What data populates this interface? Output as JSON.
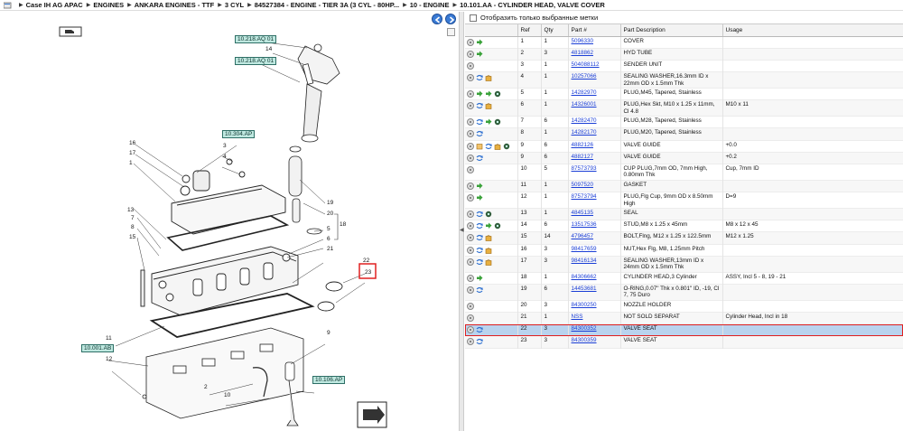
{
  "breadcrumb": {
    "items": [
      "Case IH AG APAC",
      "ENGINES",
      "ANKARA ENGINES - TTF",
      "3 CYL",
      "84527384 - ENGINE - TIER 3A (3 CYL - 80HP...",
      "10 - ENGINE",
      "10.101.AA - CYLINDER HEAD, VALVE COVER"
    ]
  },
  "filter": {
    "label": "Отобразить только выбранные метки",
    "checked": false
  },
  "table": {
    "headers": [
      "",
      "Ref",
      "Qty",
      "Part #",
      "Part Description",
      "Usage"
    ],
    "rows": [
      {
        "icons": [
          "circle-icon",
          "green-arrow-icon"
        ],
        "ref": "1",
        "qty": "1",
        "part": "5096330",
        "desc": "COVER",
        "usage": ""
      },
      {
        "icons": [
          "circle-icon",
          "green-arrow-icon"
        ],
        "ref": "2",
        "qty": "3",
        "part": "4818862",
        "desc": "HYD TUBE",
        "usage": ""
      },
      {
        "icons": [
          "circle-icon"
        ],
        "ref": "3",
        "qty": "1",
        "part": "504088112",
        "desc": "SENDER UNIT",
        "usage": ""
      },
      {
        "icons": [
          "circle-icon",
          "blue-swap-icon",
          "bag-icon"
        ],
        "ref": "4",
        "qty": "1",
        "part": "10257066",
        "desc": "SEALING WASHER,16.3mm ID x 22mm OD x 1.5mm Thk",
        "usage": ""
      },
      {
        "icons": [
          "circle-icon",
          "green-arrow-icon",
          "green-arrow-icon",
          "gear-icon"
        ],
        "ref": "5",
        "qty": "1",
        "part": "14282970",
        "desc": "PLUG,M45, Tapered, Stainless",
        "usage": ""
      },
      {
        "icons": [
          "circle-icon",
          "blue-swap-icon",
          "bag-icon"
        ],
        "ref": "6",
        "qty": "1",
        "part": "14326001",
        "desc": "PLUG,Hex Skt, M10 x 1.25 x 11mm, Cl 4.8",
        "usage": "M10 x 11"
      },
      {
        "icons": [
          "circle-icon",
          "blue-swap-icon",
          "green-arrow-icon",
          "gear-icon"
        ],
        "ref": "7",
        "qty": "6",
        "part": "14282470",
        "desc": "PLUG,M28, Tapered, Stainless",
        "usage": ""
      },
      {
        "icons": [
          "circle-icon",
          "blue-swap-icon"
        ],
        "ref": "8",
        "qty": "1",
        "part": "14282170",
        "desc": "PLUG,M20, Tapered, Stainless",
        "usage": ""
      },
      {
        "icons": [
          "circle-icon",
          "box-icon",
          "blue-swap-icon",
          "bag-icon",
          "gear-icon"
        ],
        "ref": "9",
        "qty": "6",
        "part": "4882126",
        "desc": "VALVE GUIDE",
        "usage": "+0.0"
      },
      {
        "icons": [
          "circle-icon",
          "blue-swap-icon"
        ],
        "ref": "9",
        "qty": "6",
        "part": "4882127",
        "desc": "VALVE GUIDE",
        "usage": "+0.2"
      },
      {
        "icons": [
          "circle-icon"
        ],
        "ref": "10",
        "qty": "5",
        "part": "87573793",
        "desc": "CUP PLUG,7mm OD, 7mm High, 0.80mm Thk",
        "usage": "Cup, 7mm ID"
      },
      {
        "icons": [
          "circle-icon",
          "green-arrow-icon"
        ],
        "ref": "11",
        "qty": "1",
        "part": "5097520",
        "desc": "GASKET",
        "usage": ""
      },
      {
        "icons": [
          "circle-icon",
          "green-arrow-icon"
        ],
        "ref": "12",
        "qty": "1",
        "part": "87573794",
        "desc": "PLUG,Flg Cup, 9mm OD x 8.50mm High",
        "usage": "D=9"
      },
      {
        "icons": [
          "circle-icon",
          "blue-swap-icon",
          "gear-icon"
        ],
        "ref": "13",
        "qty": "1",
        "part": "4845135",
        "desc": "SEAL",
        "usage": ""
      },
      {
        "icons": [
          "circle-icon",
          "blue-swap-icon",
          "green-arrow-icon",
          "gear-icon"
        ],
        "ref": "14",
        "qty": "6",
        "part": "13517536",
        "desc": "STUD,M8 x 1.25 x 45mm",
        "usage": "M8 x 12 x 45"
      },
      {
        "icons": [
          "circle-icon",
          "blue-swap-icon",
          "bag-icon"
        ],
        "ref": "15",
        "qty": "14",
        "part": "4796457",
        "desc": "BOLT,Flng, M12 x 1.25 x 122.5mm",
        "usage": "M12 x 1.25"
      },
      {
        "icons": [
          "circle-icon",
          "blue-swap-icon",
          "bag-icon"
        ],
        "ref": "16",
        "qty": "3",
        "part": "98417659",
        "desc": "NUT,Hex Flg, M8, 1.25mm Pitch",
        "usage": ""
      },
      {
        "icons": [
          "circle-icon",
          "blue-swap-icon",
          "bag-icon"
        ],
        "ref": "17",
        "qty": "3",
        "part": "98416134",
        "desc": "SEALING WASHER,13mm ID x 24mm OD x 1.5mm Thk",
        "usage": ""
      },
      {
        "icons": [
          "circle-icon",
          "green-arrow-icon"
        ],
        "ref": "18",
        "qty": "1",
        "part": "84306662",
        "desc": "CYLINDER HEAD,3 Cylinder",
        "usage": "ASSY, Incl 5 - 8, 19 - 21"
      },
      {
        "icons": [
          "circle-icon",
          "blue-swap-icon"
        ],
        "ref": "19",
        "qty": "6",
        "part": "14453681",
        "desc": "O-RING,0.07\" Thk x 0.801\" ID, -19, Cl 7, 75 Duro",
        "usage": ""
      },
      {
        "icons": [
          "circle-icon"
        ],
        "ref": "20",
        "qty": "3",
        "part": "84300250",
        "desc": "NOZZLE HOLDER",
        "usage": ""
      },
      {
        "icons": [
          "circle-icon"
        ],
        "ref": "21",
        "qty": "1",
        "part": "NSS",
        "desc": "NOT SOLD SEPARAT",
        "usage": "Cylinder Head, Incl in 18"
      },
      {
        "icons": [
          "circle-icon",
          "blue-swap-icon"
        ],
        "ref": "22",
        "qty": "3",
        "part": "84300352",
        "desc": "VALVE SEAT",
        "usage": "",
        "selected": true
      },
      {
        "icons": [
          "circle-icon",
          "blue-swap-icon"
        ],
        "ref": "23",
        "qty": "3",
        "part": "84300359",
        "desc": "VALVE SEAT",
        "usage": ""
      }
    ]
  },
  "diagram": {
    "callouts": [
      "10.218.AQ 01",
      "10.218.AQ 01",
      "10.304.AP",
      "10.001.AB",
      "10.106.AP"
    ],
    "numbers": [
      "14",
      "16",
      "3",
      "17",
      "4",
      "1",
      "13",
      "7",
      "8",
      "15",
      "19",
      "20",
      "18",
      "5",
      "6",
      "21",
      "22",
      "23",
      "11",
      "12",
      "9",
      "2",
      "10"
    ]
  },
  "colors": {
    "accent": "#3a7bd5",
    "selected_row": "#b9d3ee",
    "highlight": "#e02020",
    "callout_bg": "#bfe8e0"
  }
}
